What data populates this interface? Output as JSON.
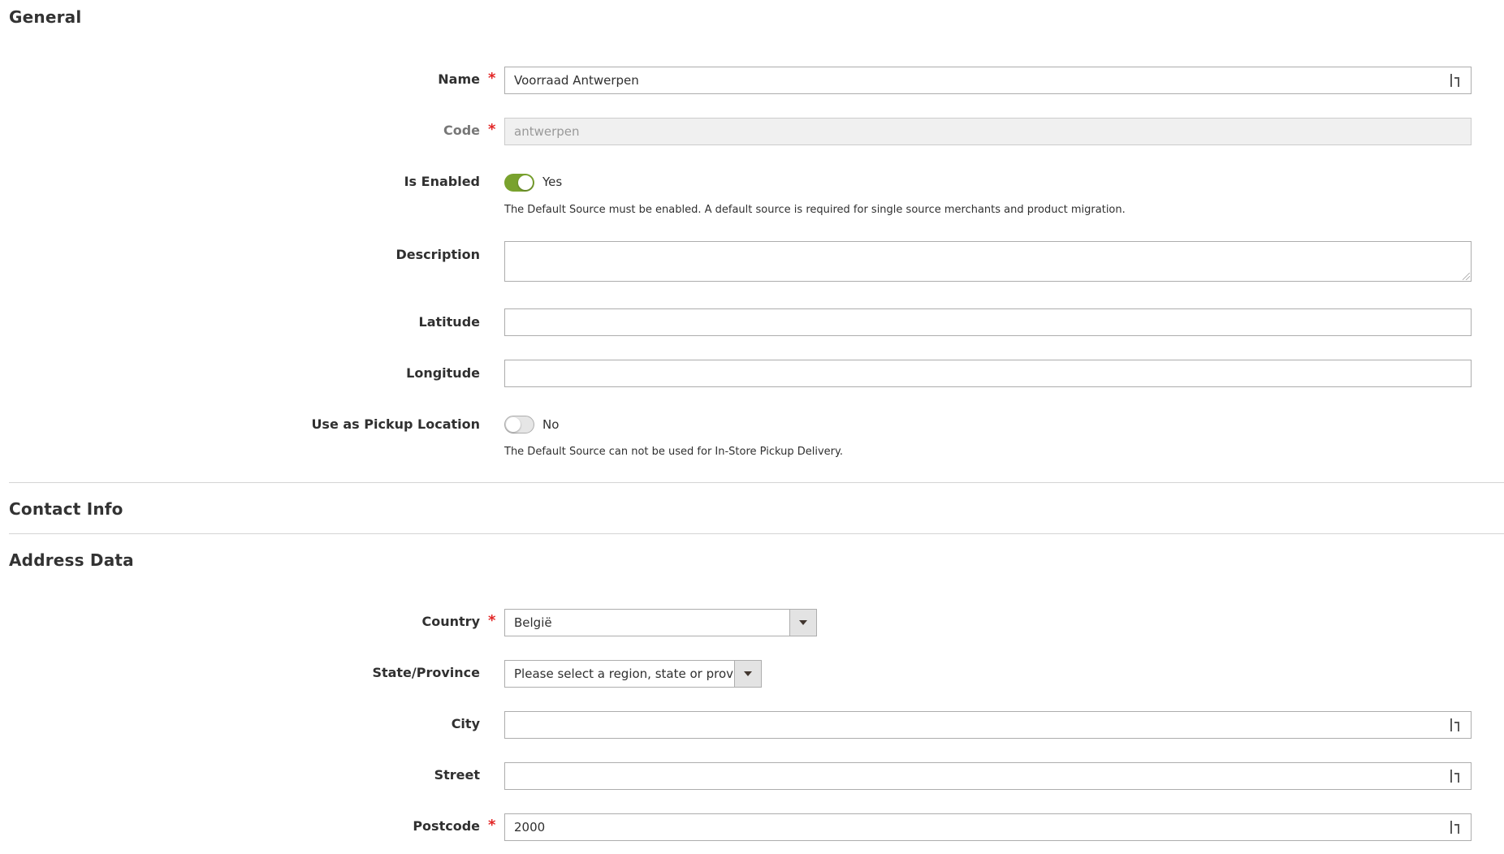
{
  "sections": {
    "general": "General",
    "contact": "Contact Info",
    "address": "Address Data"
  },
  "fields": {
    "name": {
      "label": "Name",
      "value": "Voorraad Antwerpen"
    },
    "code": {
      "label": "Code",
      "value": "antwerpen"
    },
    "is_enabled": {
      "label": "Is Enabled",
      "state": "Yes",
      "note": "The Default Source must be enabled. A default source is required for single source merchants and product migration."
    },
    "description": {
      "label": "Description",
      "value": ""
    },
    "latitude": {
      "label": "Latitude",
      "value": ""
    },
    "longitude": {
      "label": "Longitude",
      "value": ""
    },
    "pickup": {
      "label": "Use as Pickup Location",
      "state": "No",
      "note": "The Default Source can not be used for In-Store Pickup Delivery."
    },
    "country": {
      "label": "Country",
      "value": "België"
    },
    "region": {
      "label": "State/Province",
      "value": "Please select a region, state or province."
    },
    "city": {
      "label": "City",
      "value": ""
    },
    "street": {
      "label": "Street",
      "value": ""
    },
    "postcode": {
      "label": "Postcode",
      "value": "2000"
    }
  },
  "required_mark": "*",
  "colors": {
    "toggle_on": "#79a22e",
    "required": "#e22626",
    "border": "#adadad"
  }
}
